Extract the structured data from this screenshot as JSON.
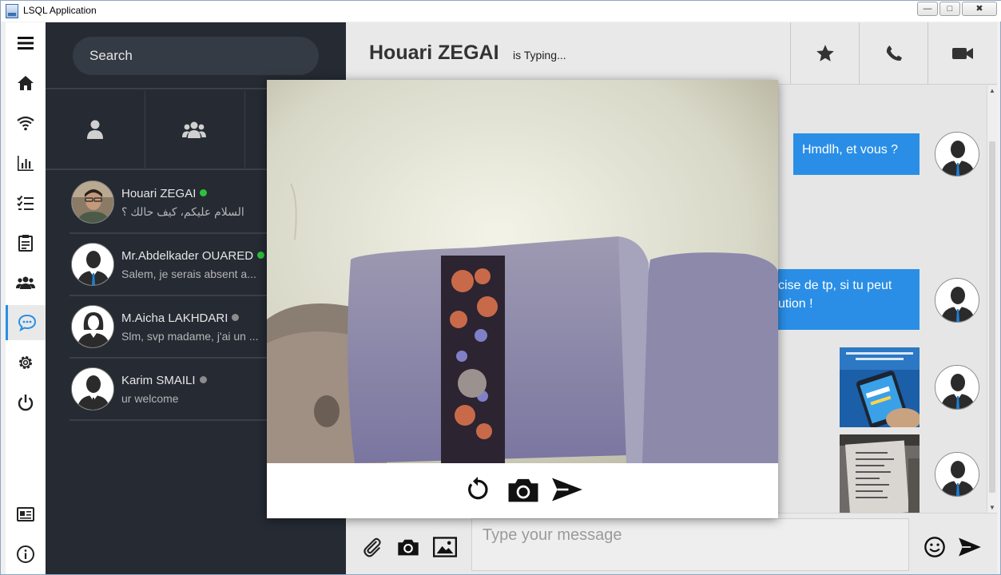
{
  "window": {
    "title": "LSQL Application",
    "minimize": "—",
    "maximize": "□",
    "close": "✖"
  },
  "nav": {
    "items": [
      {
        "icon": "menu-icon"
      },
      {
        "icon": "home-icon"
      },
      {
        "icon": "wifi-icon"
      },
      {
        "icon": "bar-chart-icon"
      },
      {
        "icon": "checklist-icon"
      },
      {
        "icon": "clipboard-icon"
      },
      {
        "icon": "group-icon"
      },
      {
        "icon": "chat-icon",
        "active": true
      },
      {
        "icon": "settings-icon"
      },
      {
        "icon": "power-icon"
      },
      {
        "icon": "id-card-icon"
      },
      {
        "icon": "info-icon"
      }
    ],
    "accent_color": "#2a8ee6"
  },
  "contacts": {
    "search_placeholder": "Search",
    "tabs": [
      {
        "icon": "person-icon"
      },
      {
        "icon": "group-icon"
      }
    ],
    "list": [
      {
        "name": "Houari ZEGAI",
        "message": "السلام عليكم، كيف حالك ؟",
        "online": true
      },
      {
        "name": "Mr.Abdelkader OUARED",
        "message": "Salem, je serais absent a...",
        "online": true
      },
      {
        "name": "M.Aicha LAKHDARI",
        "message": "Slm, svp madame, j'ai un ...",
        "online": false
      },
      {
        "name": "Karim SMAILI",
        "message": "ur welcome",
        "online": false
      }
    ],
    "status_colors": {
      "online": "#2ec13b",
      "offline": "#8c8c8c"
    }
  },
  "chat": {
    "contact_name": "Houari ZEGAI",
    "status": "is Typing...",
    "header_actions": [
      {
        "icon": "star-icon"
      },
      {
        "icon": "phone-icon"
      },
      {
        "icon": "video-icon"
      }
    ],
    "messages": [
      {
        "text": "Hmdlh, et vous ?"
      },
      {
        "line1": "cise de tp, si tu peut",
        "line2": "ution !"
      }
    ],
    "input_placeholder": "Type your message",
    "composer_actions": [
      {
        "icon": "attach-icon"
      },
      {
        "icon": "camera-icon"
      },
      {
        "icon": "image-icon"
      },
      {
        "icon": "emoji-icon"
      },
      {
        "icon": "send-icon"
      }
    ],
    "bubble_color": "#2a8ee6"
  },
  "camera_dialog": {
    "actions": [
      {
        "icon": "retake-icon"
      },
      {
        "icon": "capture-icon"
      },
      {
        "icon": "send-icon"
      }
    ]
  }
}
